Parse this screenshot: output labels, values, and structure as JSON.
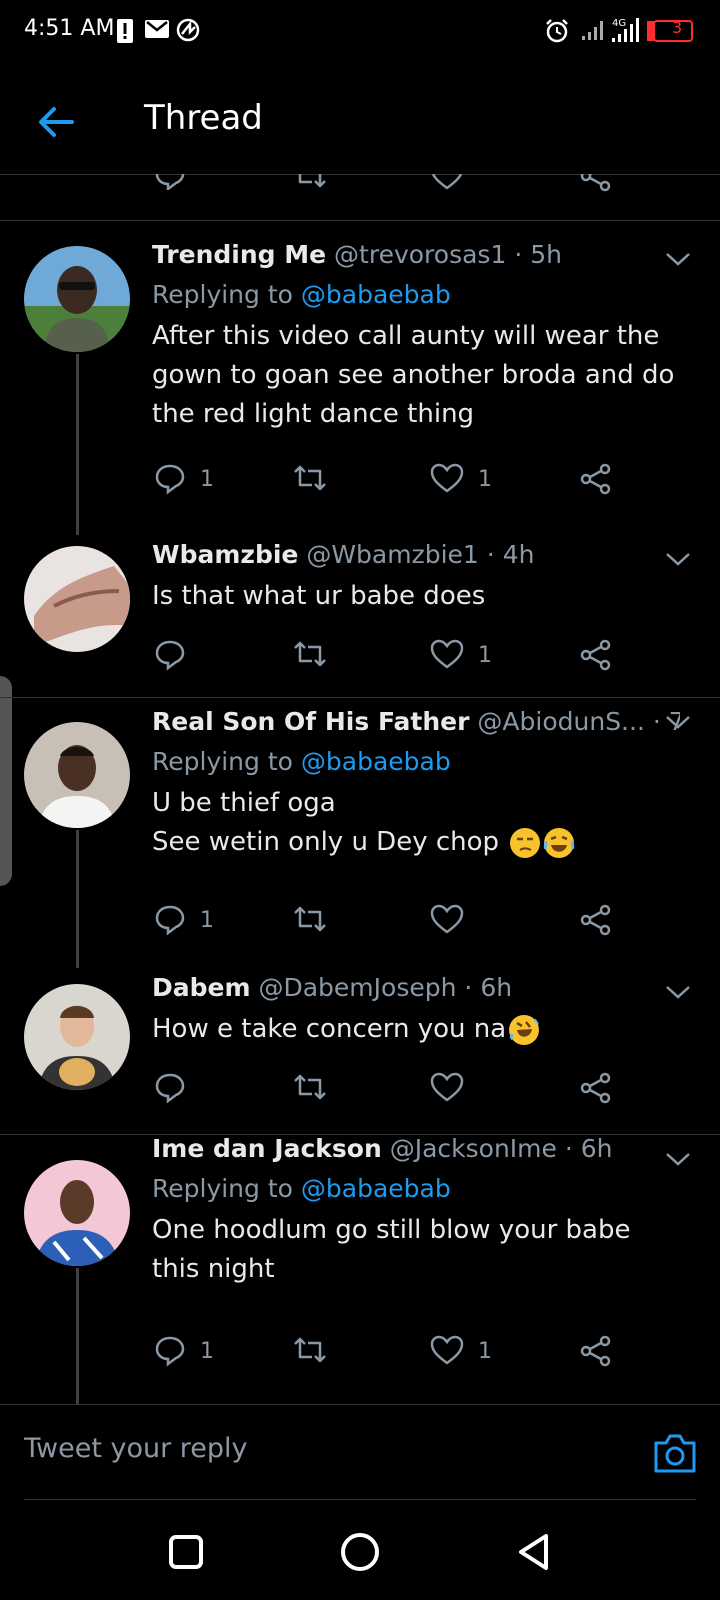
{
  "status_bar": {
    "time": "4:51 AM",
    "battery": "3",
    "network": "4G"
  },
  "header": {
    "title": "Thread"
  },
  "tweets": [
    {
      "name": "Trending Me",
      "handle": "@trevorosas1",
      "time": "5h",
      "replying_label": "Replying to",
      "replying_to": "@babaebab",
      "text": "After this video call aunty will wear the gown to goan see another broda and do the red light dance thing",
      "reply_count": "1",
      "like_count": "1"
    },
    {
      "name": "Wbamzbie",
      "handle": "@Wbamzbie1",
      "time": "4h",
      "text": "Is that what ur babe does",
      "reply_count": "",
      "like_count": "1"
    },
    {
      "name": "Real Son Of His Father",
      "handle": "@AbiodunS...",
      "time": "7h",
      "replying_label": "Replying to",
      "replying_to": "@babaebab",
      "text_line1": "U be thief oga",
      "text_line2": "See wetin only u Dey chop",
      "reply_count": "1",
      "like_count": ""
    },
    {
      "name": "Dabem",
      "handle": "@DabemJoseph",
      "time": "6h",
      "text": "How e take concern you na",
      "reply_count": "",
      "like_count": ""
    },
    {
      "name": "Ime dan Jackson",
      "handle": "@JacksonIme",
      "time": "6h",
      "replying_label": "Replying to",
      "replying_to": "@babaebab",
      "text": "One hoodlum go still blow your babe this night",
      "reply_count": "1",
      "like_count": "1"
    }
  ],
  "composer": {
    "placeholder": "Tweet your reply"
  },
  "colors": {
    "accent": "#1d9bf0",
    "muted": "#8b98a5",
    "background": "#000000"
  }
}
